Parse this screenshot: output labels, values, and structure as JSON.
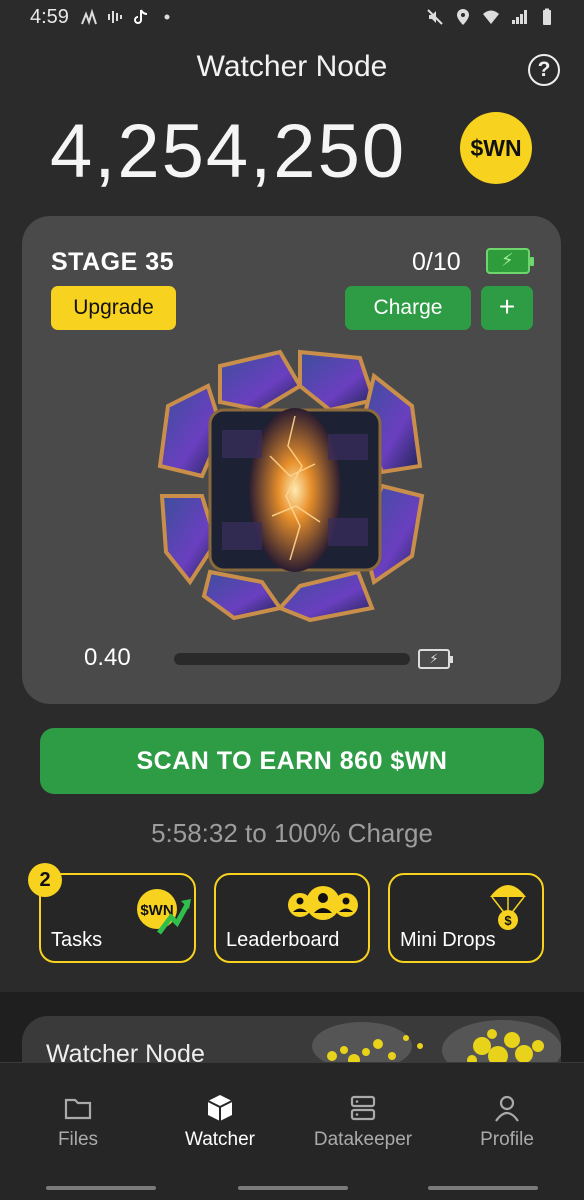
{
  "status_bar": {
    "time": "4:59",
    "left_icons": [
      "signal-activity-icon",
      "audio-wave-icon",
      "tiktok-icon",
      "dot-icon"
    ],
    "right_icons": [
      "mute-icon",
      "location-icon",
      "wifi-icon",
      "cell-signal-icon",
      "battery-icon"
    ]
  },
  "header": {
    "title": "Watcher Node",
    "help_icon": "help-circle-icon"
  },
  "balance": {
    "amount": "4,254,250",
    "coin_label": "$WN"
  },
  "stage_card": {
    "stage_label": "STAGE 35",
    "charges": "0/10",
    "upgrade_label": "Upgrade",
    "charge_label": "Charge",
    "plus_label": "+",
    "progress_value_text": "0.40",
    "progress_fraction": 0.0,
    "colors": {
      "accent_yellow": "#f7d21e",
      "accent_green": "#2e9c45"
    }
  },
  "scan": {
    "button_label": "SCAN TO EARN 860 $WN",
    "timer_text": "5:58:32 to 100% Charge"
  },
  "tiles": [
    {
      "label": "Tasks",
      "icon": "wn-coin-trend-icon",
      "badge": "2"
    },
    {
      "label": "Leaderboard",
      "icon": "users-group-icon"
    },
    {
      "label": "Mini Drops",
      "icon": "parachute-coin-icon"
    }
  ],
  "tile_icon_coin_text": "$WN",
  "tile_icon_drop_coin": "$",
  "watcher_card": {
    "title": "Watcher Node"
  },
  "bottom_nav": {
    "items": [
      {
        "label": "Files",
        "icon": "folder-icon",
        "active": false
      },
      {
        "label": "Watcher",
        "icon": "cube-icon",
        "active": true
      },
      {
        "label": "Datakeeper",
        "icon": "server-icon",
        "active": false
      },
      {
        "label": "Profile",
        "icon": "user-icon",
        "active": false
      }
    ]
  }
}
